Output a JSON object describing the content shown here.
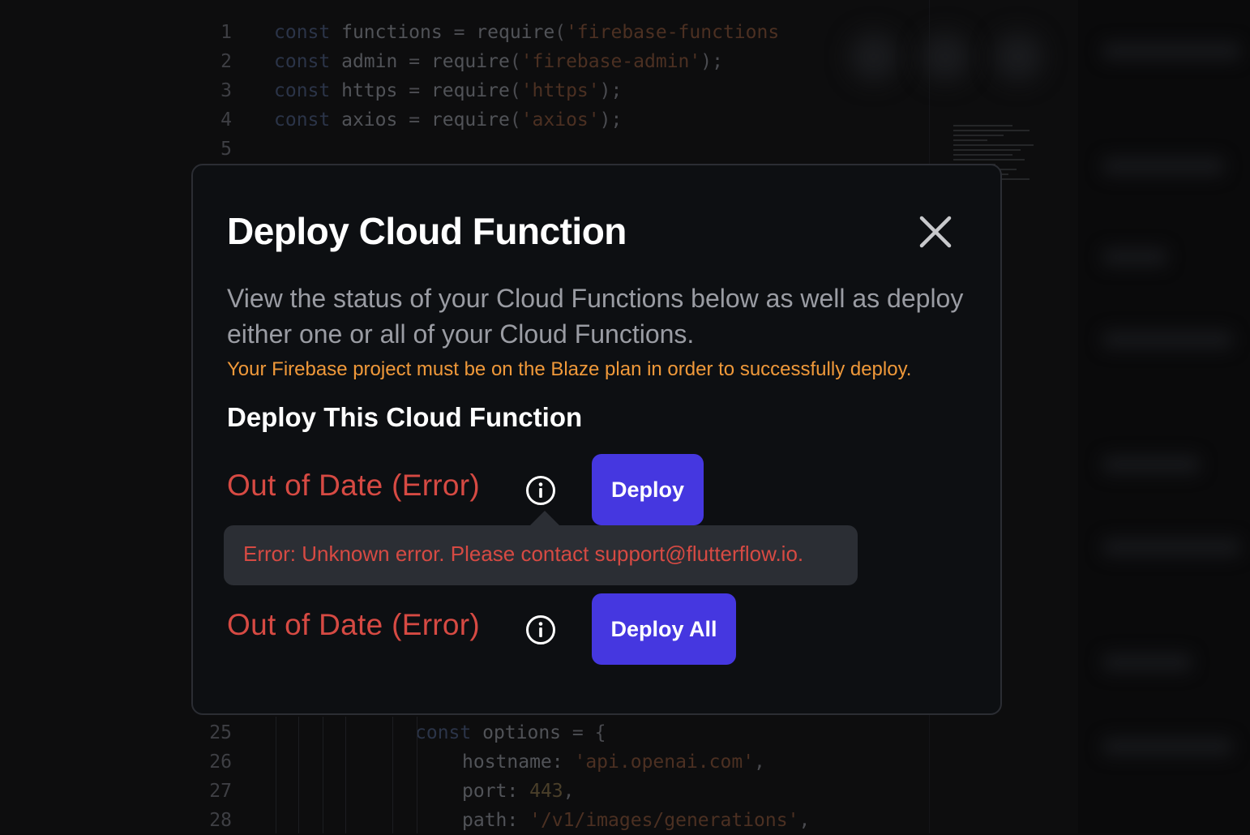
{
  "editor": {
    "lines": [
      {
        "num": "1",
        "tokens": [
          [
            "kw",
            "const "
          ],
          [
            "id",
            "functions "
          ],
          [
            "punct",
            "= "
          ],
          [
            "id",
            "require"
          ],
          [
            "punct",
            "("
          ],
          [
            "str",
            "'firebase-functions"
          ]
        ]
      },
      {
        "num": "2",
        "tokens": [
          [
            "kw",
            "const "
          ],
          [
            "id",
            "admin "
          ],
          [
            "punct",
            "= "
          ],
          [
            "id",
            "require"
          ],
          [
            "punct",
            "("
          ],
          [
            "str",
            "'firebase-admin'"
          ],
          [
            "punct",
            ");"
          ]
        ]
      },
      {
        "num": "3",
        "tokens": [
          [
            "kw",
            "const "
          ],
          [
            "id",
            "https "
          ],
          [
            "punct",
            "= "
          ],
          [
            "id",
            "require"
          ],
          [
            "punct",
            "("
          ],
          [
            "str",
            "'https'"
          ],
          [
            "punct",
            ");"
          ]
        ]
      },
      {
        "num": "4",
        "tokens": [
          [
            "kw",
            "const "
          ],
          [
            "id",
            "axios "
          ],
          [
            "punct",
            "= "
          ],
          [
            "id",
            "require"
          ],
          [
            "punct",
            "("
          ],
          [
            "str",
            "'axios'"
          ],
          [
            "punct",
            ");"
          ]
        ]
      },
      {
        "num": "5",
        "tokens": []
      },
      {
        "num": "25",
        "tokens": [
          [
            "kw",
            "const "
          ],
          [
            "id",
            "options "
          ],
          [
            "punct",
            "= {"
          ]
        ]
      },
      {
        "num": "26",
        "tokens": [
          [
            "id",
            "hostname: "
          ],
          [
            "str",
            "'api.openai.com'"
          ],
          [
            "punct",
            ","
          ]
        ]
      },
      {
        "num": "27",
        "tokens": [
          [
            "id",
            "port: "
          ],
          [
            "num",
            "443"
          ],
          [
            "punct",
            ","
          ]
        ]
      },
      {
        "num": "28",
        "tokens": [
          [
            "id",
            "path: "
          ],
          [
            "str",
            "'/v1/images/generations'"
          ],
          [
            "punct",
            ","
          ]
        ]
      }
    ]
  },
  "modal": {
    "title": "Deploy Cloud Function",
    "description": "View the status of your Cloud Functions below as well as deploy either one or all of your Cloud Functions.",
    "warning": "Your Firebase project must be on the Blaze plan in order to successfully deploy.",
    "section_title": "Deploy This Cloud Function",
    "single": {
      "status": "Out of Date (Error)",
      "button": "Deploy"
    },
    "tooltip": "Error: Unknown error. Please contact support@flutterflow.io.",
    "all": {
      "status": "Out of Date (Error)",
      "button": "Deploy All"
    }
  },
  "colors": {
    "accent": "#4537e0",
    "error": "#d64a43",
    "warning": "#f0993a",
    "modal_bg": "#0d0f12",
    "tooltip_bg": "#2b2e34"
  },
  "icons": {
    "close": "close-icon",
    "info": "info-icon"
  }
}
